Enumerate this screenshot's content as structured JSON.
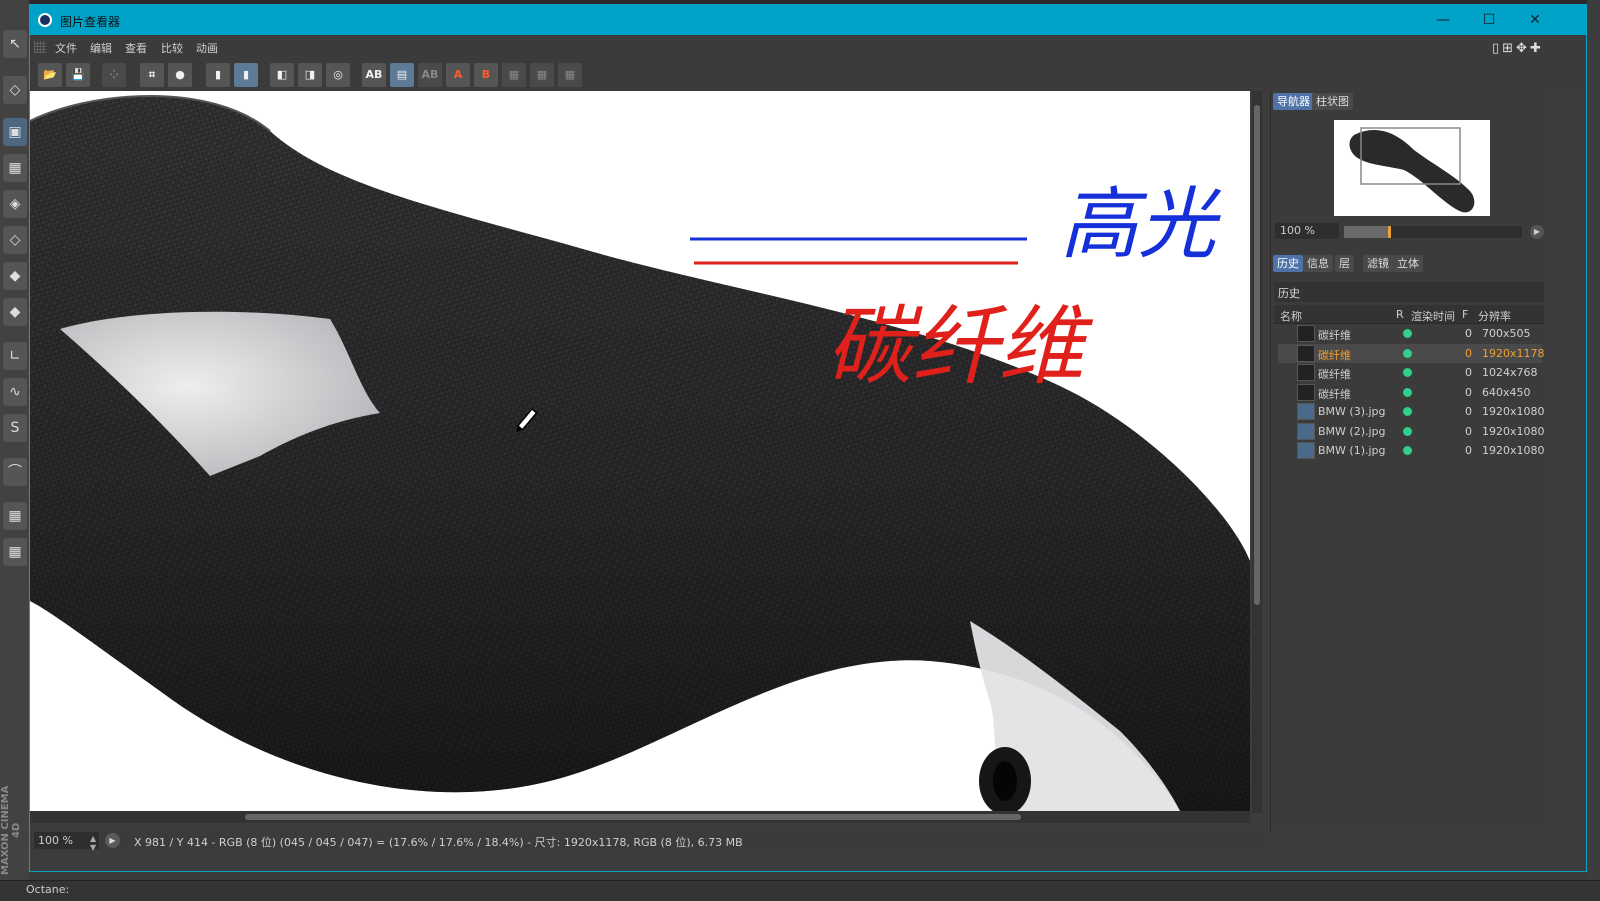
{
  "window": {
    "title": "图片查看器"
  },
  "menu": [
    "文件",
    "编辑",
    "查看",
    "比较",
    "动画"
  ],
  "toolbar": {
    "compare_a": "A",
    "compare_b": "B"
  },
  "viewer": {
    "annotation_highlight": "高光",
    "annotation_carbon": "碳纤维"
  },
  "status": {
    "zoom": "100 %",
    "text": "X 981 / Y 414 - RGB (8 位) (045 / 045 / 047) = (17.6% / 17.6% / 18.4%) - 尺寸: 1920x1178, RGB (8 位), 6.73 MB"
  },
  "panel": {
    "top_tabs": [
      "导航器",
      "柱状图"
    ],
    "nav_zoom": "100 %",
    "nav_slider_fraction": 0.25,
    "bottom_tabs": [
      "历史",
      "信息",
      "层",
      "滤镜",
      "立体"
    ],
    "history_title": "历史",
    "columns": {
      "name": "名称",
      "r": "R",
      "render_time": "渲染时间",
      "f": "F",
      "resolution": "分辨率"
    },
    "rows": [
      {
        "name": "碳纤维",
        "frame": "0",
        "resolution": "700x505"
      },
      {
        "name": "碳纤维",
        "frame": "0",
        "resolution": "1920x1178"
      },
      {
        "name": "碳纤维",
        "frame": "0",
        "resolution": "1024x768"
      },
      {
        "name": "碳纤维",
        "frame": "0",
        "resolution": "640x450"
      },
      {
        "name": "BMW (3).jpg",
        "frame": "0",
        "resolution": "1920x1080"
      },
      {
        "name": "BMW (2).jpg",
        "frame": "0",
        "resolution": "1920x1080"
      },
      {
        "name": "BMW (1).jpg",
        "frame": "0",
        "resolution": "1920x1080"
      }
    ]
  },
  "background_app": {
    "brand": "MAXON CINEMA 4D",
    "console_label": "Octane:"
  },
  "colors": {
    "titlebar": "#00a2c8",
    "selected_row_text": "#f0a030",
    "status_dot": "#2fd08a",
    "annotation_blue": "#1530d8",
    "annotation_red": "#e0201a"
  }
}
